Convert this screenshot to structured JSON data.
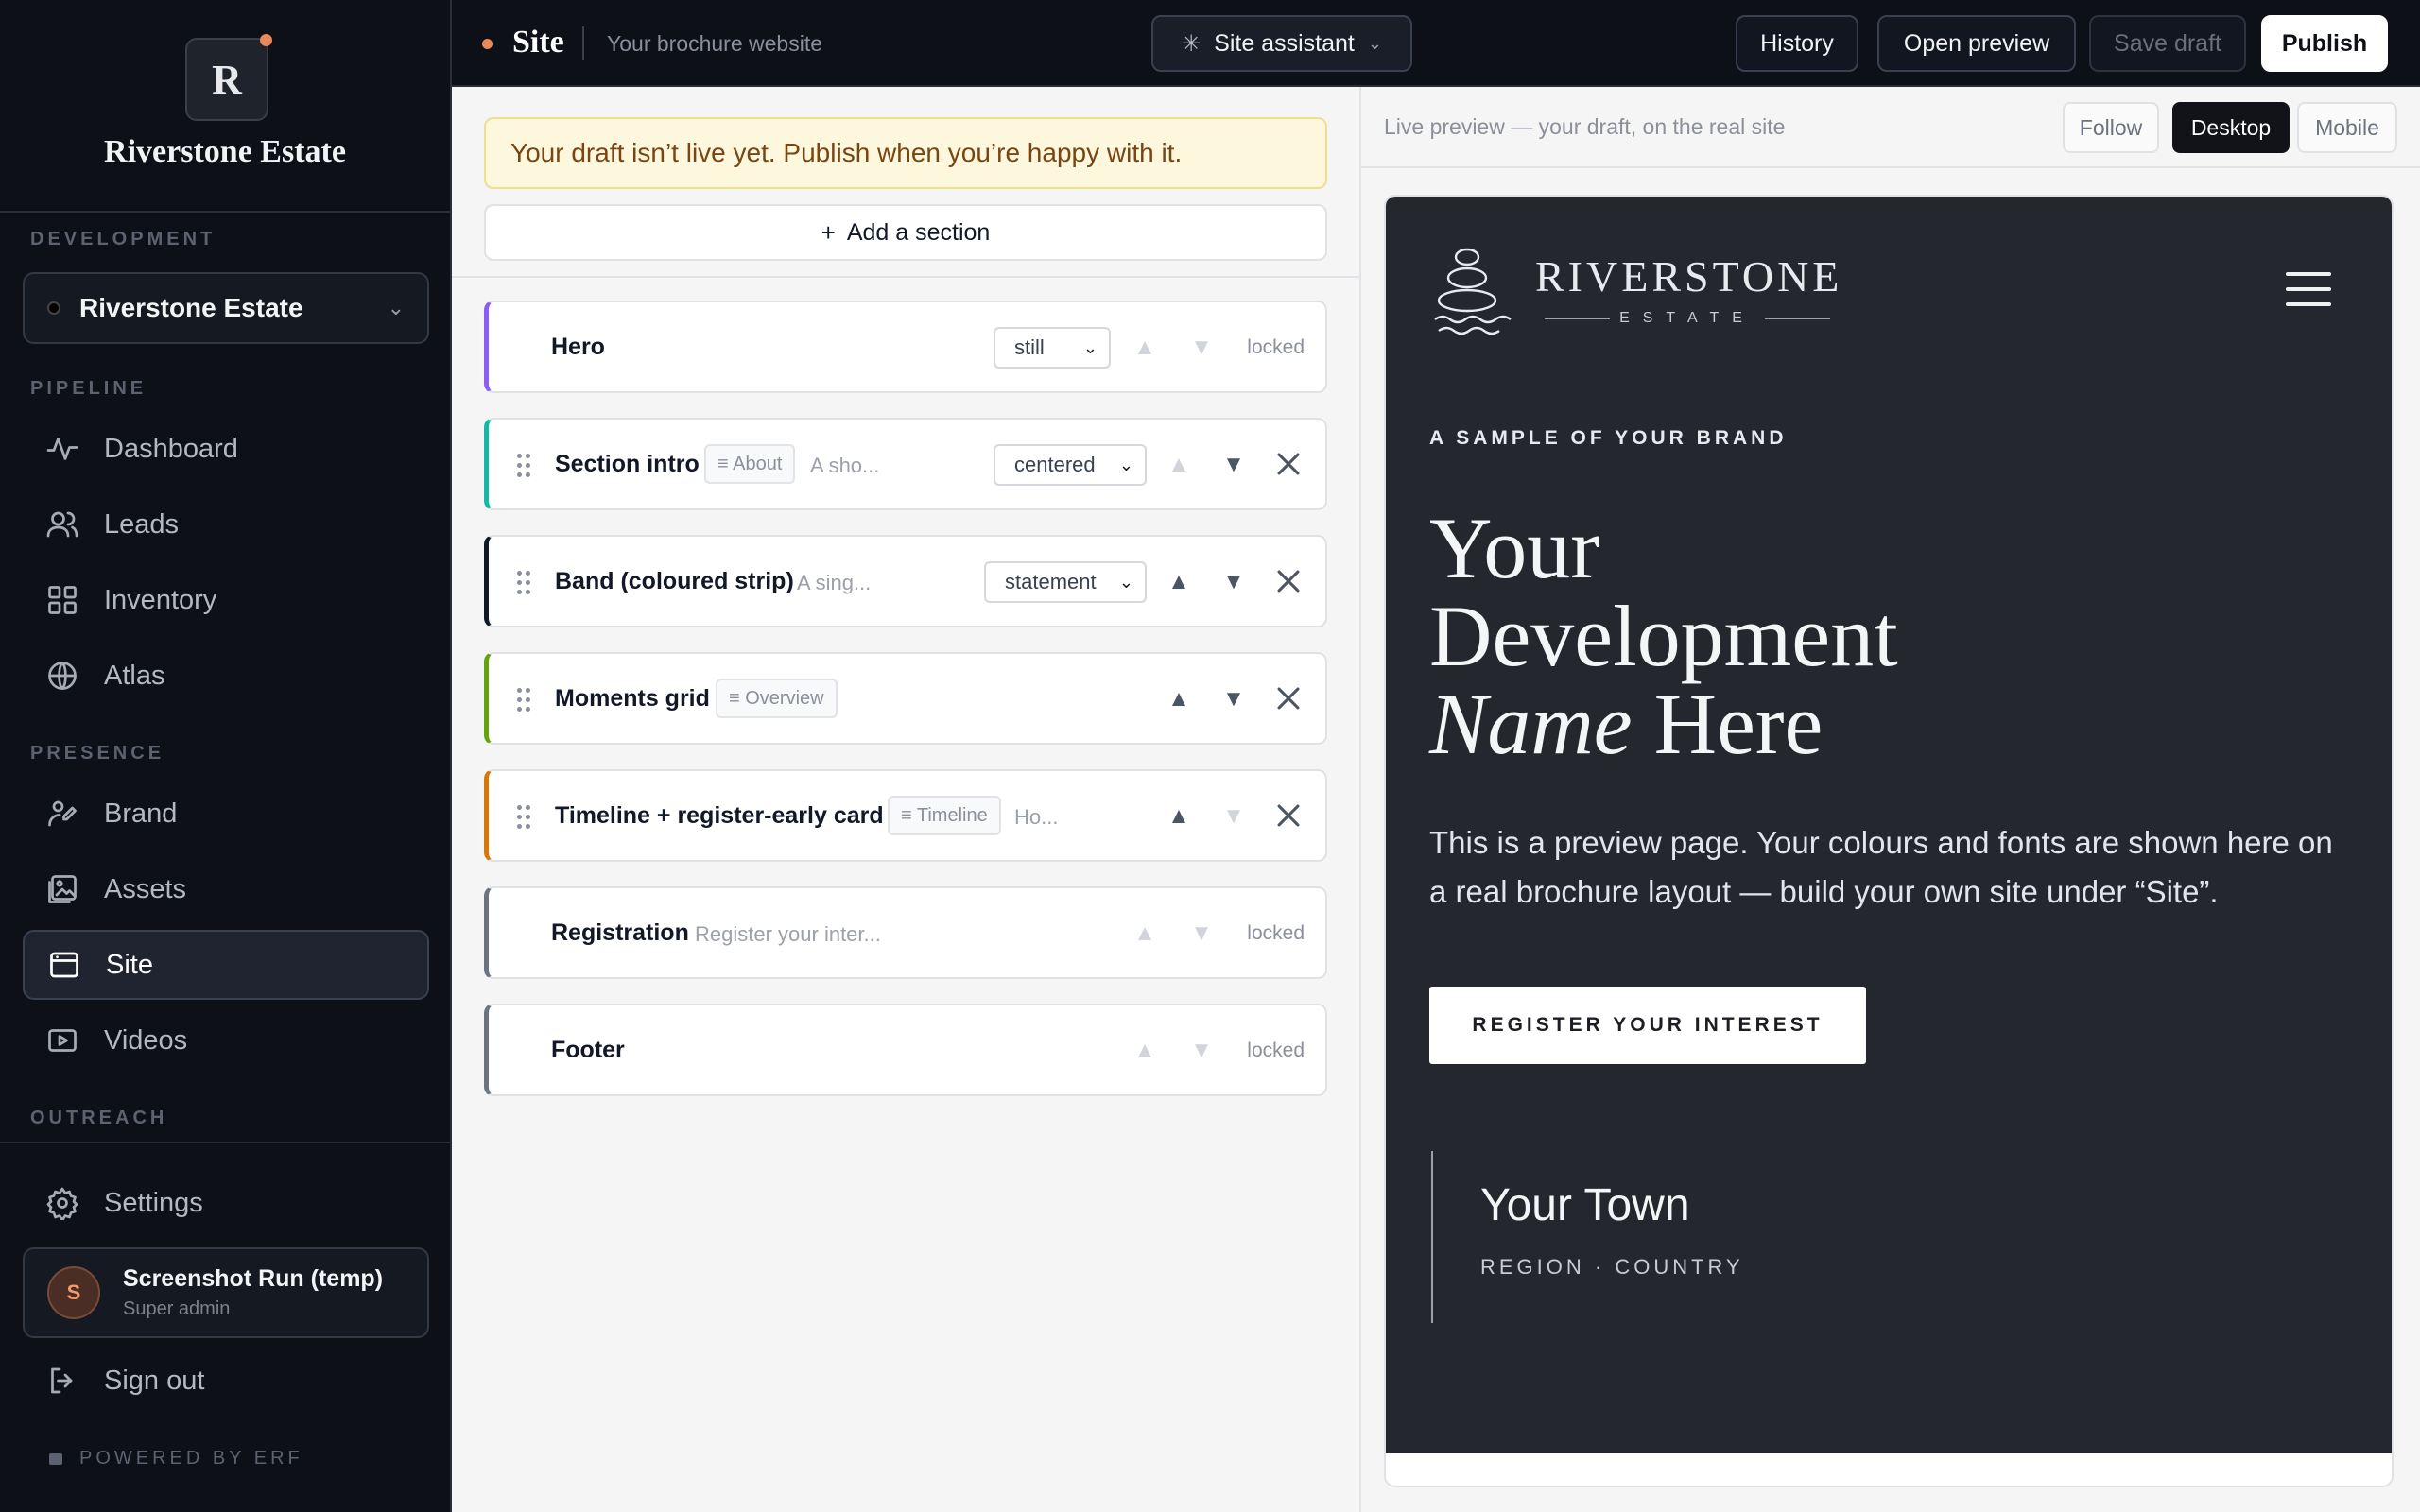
{
  "sidebar": {
    "logo_letter": "R",
    "brand_name": "Riverstone Estate",
    "development_label": "DEVELOPMENT",
    "development_selected": "Riverstone Estate",
    "pipeline_label": "PIPELINE",
    "presence_label": "PRESENCE",
    "outreach_label": "OUTREACH",
    "nav": {
      "dashboard": "Dashboard",
      "leads": "Leads",
      "inventory": "Inventory",
      "atlas": "Atlas",
      "brand": "Brand",
      "assets": "Assets",
      "site": "Site",
      "videos": "Videos",
      "settings": "Settings"
    },
    "user": {
      "initial": "S",
      "name": "Screenshot Run (temp)",
      "role": "Super admin"
    },
    "sign_out": "Sign out",
    "powered_by": "POWERED BY ERF"
  },
  "topbar": {
    "title": "Site",
    "subtitle": "Your brochure website",
    "assistant": "Site assistant",
    "history": "History",
    "open_preview": "Open preview",
    "save_draft": "Save draft",
    "publish": "Publish"
  },
  "editor": {
    "draft_banner": "Your draft isn’t live yet. Publish when you’re happy with it.",
    "add_section": "Add a section",
    "locked_label": "locked",
    "sections": [
      {
        "name": "Hero",
        "variant": "still",
        "accent": "#8b5cf6"
      },
      {
        "name": "Section intro",
        "tag": "≡ About",
        "snippet": "A sho...",
        "variant": "centered",
        "accent": "#14b8a6"
      },
      {
        "name": "Band (coloured strip)",
        "snippet": "A sing...",
        "variant": "statement",
        "accent": "#111827"
      },
      {
        "name": "Moments grid",
        "tag": "≡ Overview",
        "accent": "#65a30d"
      },
      {
        "name": "Timeline + register-early card",
        "tag": "≡ Timeline",
        "snippet": "Ho...",
        "accent": "#d97706"
      },
      {
        "name": "Registration",
        "snippet": "Register your inter...",
        "accent": "#6b7280"
      },
      {
        "name": "Footer",
        "accent": "#6b7280"
      }
    ]
  },
  "preview": {
    "label": "Live preview — your draft, on the real site",
    "follow": "Follow",
    "desktop": "Desktop",
    "mobile": "Mobile",
    "site_name": "RIVERSTONE",
    "site_sub": "ESTATE",
    "eyebrow": "A SAMPLE OF YOUR BRAND",
    "title_line1": "Your",
    "title_line2": "Development",
    "title_italic": "Name",
    "title_end": "Here",
    "body": "This is a preview page. Your colours and fonts are shown here on a real brochure layout — build your own site under “Site”.",
    "cta": "REGISTER YOUR INTEREST",
    "town": "Your Town",
    "region": "REGION · COUNTRY"
  },
  "colors": {
    "accent_orange": "#e9895a",
    "sidebar_bg": "#0d1017",
    "banner_bg": "#fdf7dd",
    "preview_bg": "#24272e"
  }
}
